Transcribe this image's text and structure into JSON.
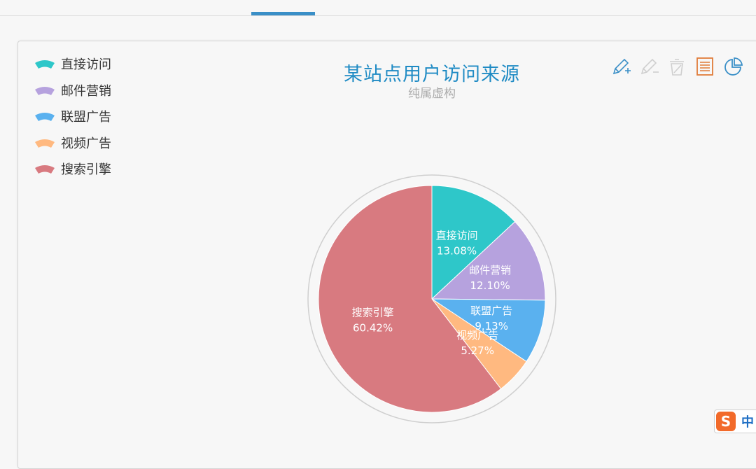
{
  "chart_data": {
    "type": "pie",
    "title": "某站点用户访问来源",
    "subtitle": "纯属虚构",
    "legend_position": "top-left",
    "slices": [
      {
        "name": "直接访问",
        "percent": "13.08%",
        "value": 13.08,
        "color": "#2ec7c9"
      },
      {
        "name": "邮件营销",
        "percent": "12.10%",
        "value": 12.1,
        "color": "#b6a2de"
      },
      {
        "name": "联盟广告",
        "percent": "9.13%",
        "value": 9.13,
        "color": "#5ab1ef"
      },
      {
        "name": "视频广告",
        "percent": "5.27%",
        "value": 5.27,
        "color": "#ffb980"
      },
      {
        "name": "搜索引擎",
        "percent": "60.42%",
        "value": 60.42,
        "color": "#d87a80"
      }
    ]
  },
  "legend": {
    "items": [
      {
        "label": "直接访问",
        "color": "#2ec7c9"
      },
      {
        "label": "邮件营销",
        "color": "#b6a2de"
      },
      {
        "label": "联盟广告",
        "color": "#5ab1ef"
      },
      {
        "label": "视频广告",
        "color": "#ffb980"
      },
      {
        "label": "搜索引擎",
        "color": "#d87a80"
      }
    ]
  },
  "toolbox": {
    "icons": [
      "data-zoom-icon",
      "data-zoom-reset-icon",
      "data-view-icon",
      "restore-icon",
      "pie-chart-icon"
    ]
  },
  "ime": {
    "logo": "S",
    "text": "中"
  },
  "colors": {
    "accent": "#1f8bc4",
    "tab_indicator": "#3a8fc7"
  }
}
